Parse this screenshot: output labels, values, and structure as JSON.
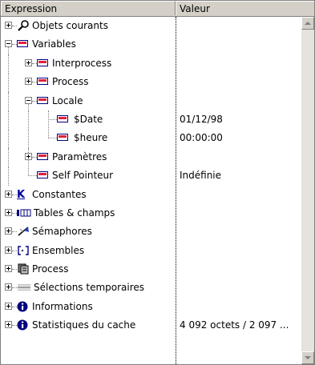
{
  "header": {
    "expression": "Expression",
    "value": "Valeur"
  },
  "tree": {
    "objets_courants": "Objets courants",
    "variables": "Variables",
    "interprocess": "Interprocess",
    "process": "Process",
    "locale": "Locale",
    "date_var": "$Date",
    "date_val": "01/12/98",
    "heure_var": "$heure",
    "heure_val": "00:00:00",
    "parametres": "Paramètres",
    "self_pointeur": "Self Pointeur",
    "self_pointeur_val": "Indéfinie",
    "constantes": "Constantes",
    "tables_champs": "Tables & champs",
    "semaphores": "Sémaphores",
    "ensembles": "Ensembles",
    "process_root": "Process",
    "selections": "Sélections temporaires",
    "informations": "Informations",
    "stats_cache": "Statistiques du cache",
    "stats_cache_val": "4 092 octets / 2 097 ..."
  },
  "icons": {
    "constantes_glyph": "K",
    "envelope_color": "#e02040",
    "accent_blue": "#000080"
  }
}
